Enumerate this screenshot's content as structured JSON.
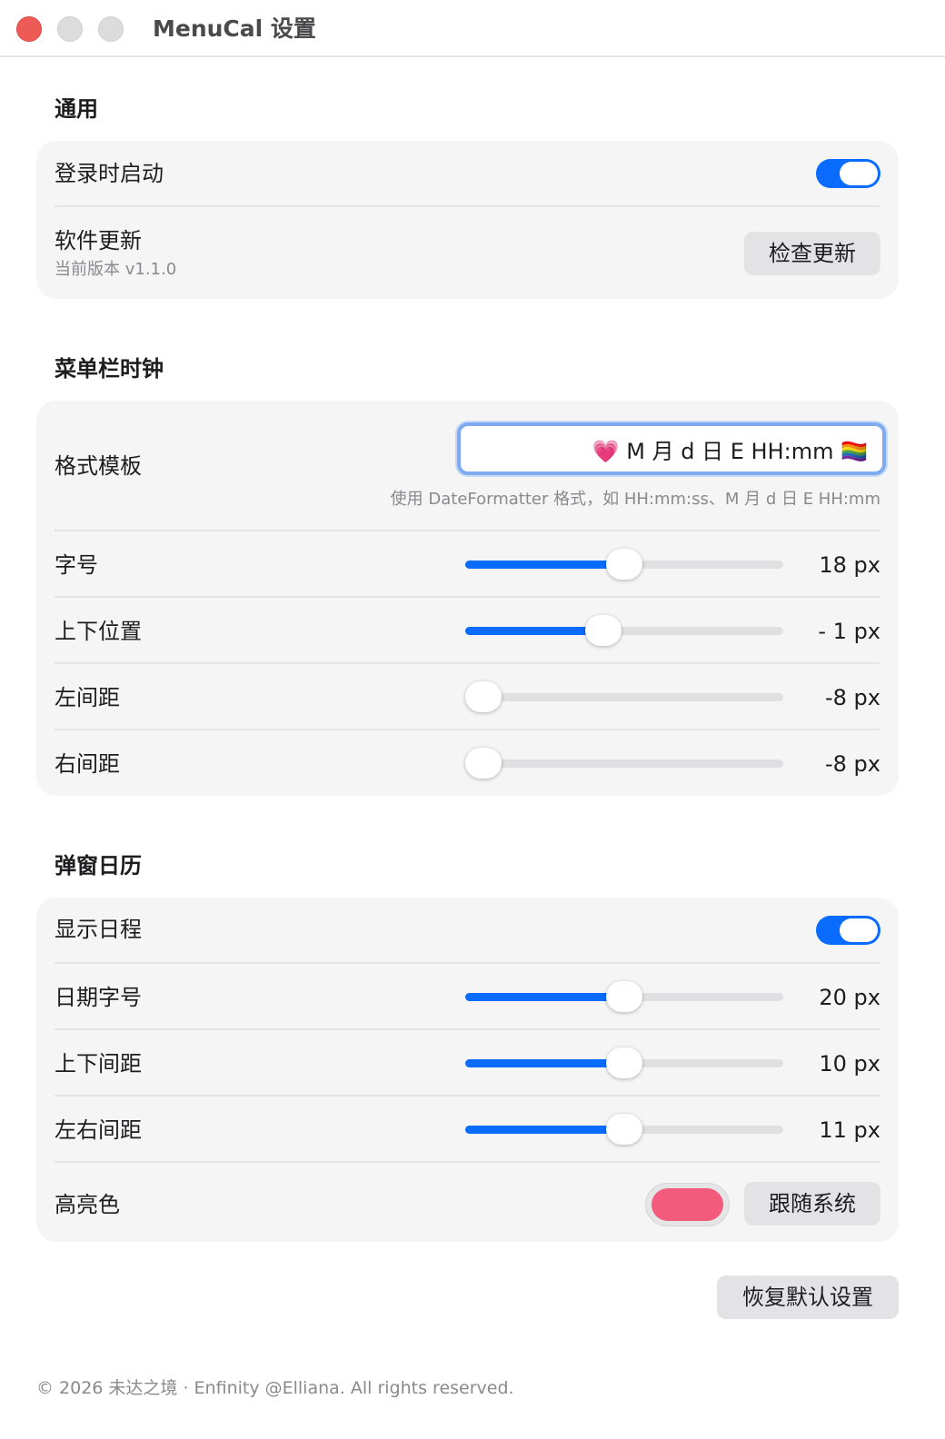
{
  "window": {
    "title": "MenuCal 设置"
  },
  "general": {
    "title": "通用",
    "launch_at_login": {
      "label": "登录时启动",
      "on": true
    },
    "software_update": {
      "label": "软件更新",
      "version": "当前版本 v1.1.0",
      "button": "检查更新"
    }
  },
  "menubar_clock": {
    "title": "菜单栏时钟",
    "format": {
      "label": "格式模板",
      "value": "💗 M 月 d 日 E HH:mm 🏳️‍🌈",
      "hint": "使用 DateFormatter 格式，如 HH:mm:ss、M 月 d 日 E HH:mm"
    },
    "font_size": {
      "label": "字号",
      "value": "18 px",
      "level": 0.5
    },
    "vertical_offset": {
      "label": "上下位置",
      "value": "- 1 px",
      "level": 0.425
    },
    "left_padding": {
      "label": "左间距",
      "value": "-8 px",
      "level": 0.0
    },
    "right_padding": {
      "label": "右间距",
      "value": "-8 px",
      "level": 0.0
    }
  },
  "popup_calendar": {
    "title": "弹窗日历",
    "show_events": {
      "label": "显示日程",
      "on": true
    },
    "date_font_size": {
      "label": "日期字号",
      "value": "20 px",
      "level": 0.5
    },
    "vertical_spacing": {
      "label": "上下间距",
      "value": "10 px",
      "level": 0.5
    },
    "horizontal_spacing": {
      "label": "左右间距",
      "value": "11 px",
      "level": 0.5
    },
    "highlight_color": {
      "label": "高亮色",
      "color": "#f25b7c",
      "button": "跟随系统"
    }
  },
  "reset_button": "恢复默认设置",
  "footer": "© 2026 未达之境 · Enfinity @Elliana. All rights reserved.",
  "colors": {
    "accent": "#0a6cff",
    "close": "#ee5a55"
  }
}
